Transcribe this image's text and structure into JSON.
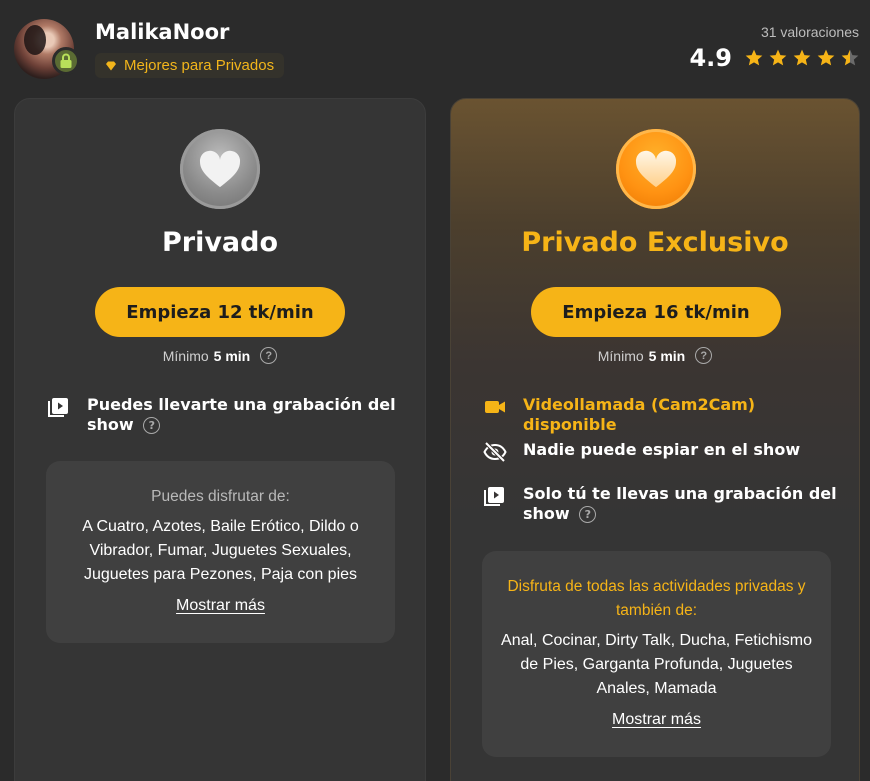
{
  "model": {
    "name": "MalikaNoor",
    "badge_label": "Mejores para Privados",
    "ratings_count": "31 valoraciones",
    "rating": "4.9",
    "stars": 4.5
  },
  "colors": {
    "accent": "#f6b417",
    "background": "#2b2b2b",
    "card": "#353535"
  },
  "private": {
    "icon": "heart-icon",
    "title": "Privado",
    "start_label": "Empieza 12 tk/min",
    "minimum_label": "Mínimo",
    "minimum_value": "5 min",
    "features": [
      {
        "icon": "recording-icon",
        "text": "Puedes llevarte una grabación del show"
      }
    ],
    "activities_heading": "Puedes disfrutar de:",
    "activities": "A Cuatro, Azotes, Baile Erótico, Dildo o Vibrador, Fumar, Juguetes Sexuales, Juguetes para Pezones, Paja con pies",
    "show_more": "Mostrar más"
  },
  "exclusive": {
    "icon": "heart-icon",
    "title": "Privado Exclusivo",
    "start_label": "Empieza 16 tk/min",
    "minimum_label": "Mínimo",
    "minimum_value": "5 min",
    "features": [
      {
        "icon": "video-camera-icon",
        "text": "Videollamada (Cam2Cam) disponible"
      },
      {
        "icon": "eye-off-icon",
        "text": "Nadie puede espiar en el show"
      },
      {
        "icon": "recording-icon",
        "text": "Solo tú te llevas una grabación del show"
      }
    ],
    "activities_heading": "Disfruta de todas las actividades privadas y también de:",
    "activities": "Anal, Cocinar, Dirty Talk, Ducha, Fetichismo de Pies, Garganta Profunda, Juguetes Anales, Mamada",
    "show_more": "Mostrar más"
  }
}
